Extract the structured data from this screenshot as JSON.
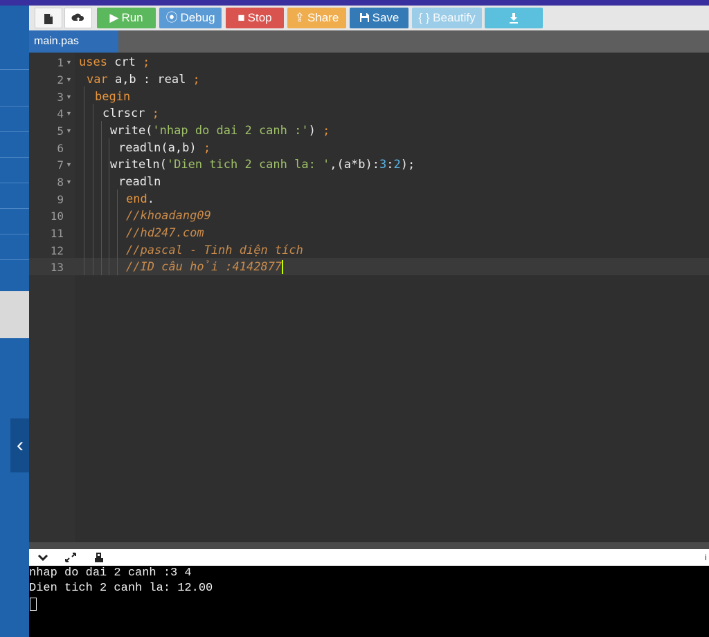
{
  "toolbar": {
    "new_file_icon": "file-icon",
    "upload_icon": "cloud-upload-icon",
    "run_label": "Run",
    "debug_label": "Debug",
    "stop_label": "Stop",
    "share_label": "Share",
    "save_label": "Save",
    "beautify_label": "{ } Beautify",
    "download_icon": "download-icon",
    "colors": {
      "run": "#5cb85c",
      "debug": "#5b9bd5",
      "stop": "#d9534f",
      "share": "#f0ad4e",
      "save": "#337ab7",
      "beautify": "#9ccde8",
      "download": "#5bc0de"
    }
  },
  "tab": {
    "label": "main.pas"
  },
  "editor": {
    "line_numbers": [
      "1",
      "2",
      "3",
      "4",
      "5",
      "6",
      "7",
      "8",
      "9",
      "10",
      "11",
      "12",
      "13"
    ],
    "lines": [
      [
        "uses",
        " crt ",
        ";"
      ],
      [
        "var",
        " a,b : real ",
        ";"
      ],
      [
        "begin"
      ],
      [
        "clrscr ",
        ";"
      ],
      [
        "write(",
        "'nhap do dai 2 canh :'",
        ") ",
        ";"
      ],
      [
        "readln(a,b) ",
        ";"
      ],
      [
        "writeln(",
        "'Dien tich 2 canh la: '",
        ",(a*b):",
        "3",
        ":",
        "2",
        ");"
      ],
      [
        "readln"
      ],
      [
        "end",
        "."
      ],
      [
        "//khoadang09"
      ],
      [
        "//hd247.com"
      ],
      [
        "//pascal - Tinh diện tích"
      ],
      [
        "//ID câu hỏi :4142877"
      ]
    ]
  },
  "console": {
    "line1": "nhap do dai 2 canh :3 4",
    "line2": "Dien tich 2 canh la: 12.00"
  }
}
